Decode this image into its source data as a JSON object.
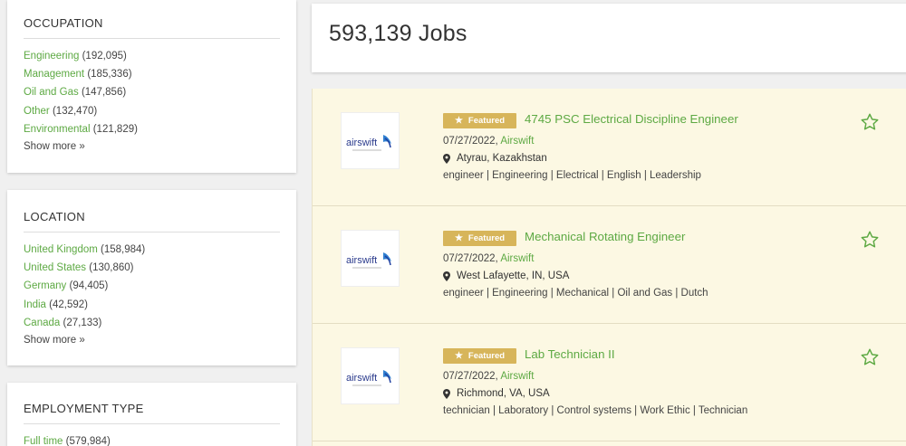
{
  "sidebar": {
    "facets": [
      {
        "title": "OCCUPATION",
        "items": [
          {
            "label": "Engineering",
            "count": "(192,095)"
          },
          {
            "label": "Management",
            "count": "(185,336)"
          },
          {
            "label": "Oil and Gas",
            "count": "(147,856)"
          },
          {
            "label": "Other",
            "count": "(132,470)"
          },
          {
            "label": "Environmental",
            "count": "(121,829)"
          }
        ],
        "show_more": "Show more »"
      },
      {
        "title": "LOCATION",
        "items": [
          {
            "label": "United Kingdom",
            "count": "(158,984)"
          },
          {
            "label": "United States",
            "count": "(130,860)"
          },
          {
            "label": "Germany",
            "count": "(94,405)"
          },
          {
            "label": "India",
            "count": "(42,592)"
          },
          {
            "label": "Canada",
            "count": "(27,133)"
          }
        ],
        "show_more": "Show more »"
      },
      {
        "title": "EMPLOYMENT TYPE",
        "items": [
          {
            "label": "Full time",
            "count": "(579,984)"
          }
        ]
      }
    ]
  },
  "results": {
    "count_text": "593,139 Jobs"
  },
  "jobs": [
    {
      "badge": "Featured",
      "title": "4745 PSC Electrical Discipline Engineer",
      "date": "07/27/2022,",
      "company": "Airswift",
      "location": "Atyrau, Kazakhstan",
      "tags": "engineer | Engineering | Electrical | English | Leadership",
      "logo_text": "airswift"
    },
    {
      "badge": "Featured",
      "title": "Mechanical Rotating Engineer",
      "date": "07/27/2022,",
      "company": "Airswift",
      "location": "West Lafayette, IN, USA",
      "tags": "engineer | Engineering | Mechanical | Oil and Gas | Dutch",
      "logo_text": "airswift"
    },
    {
      "badge": "Featured",
      "title": "Lab Technician II",
      "date": "07/27/2022,",
      "company": "Airswift",
      "location": "Richmond, VA, USA",
      "tags": "technician | Laboratory | Control systems | Work Ethic | Technician",
      "logo_text": "airswift"
    }
  ],
  "colors": {
    "link": "#5da943",
    "featured_bg": "#fcf8e3",
    "badge": "#d7b55a"
  },
  "icons": {
    "badge": "star-icon",
    "location": "map-pin-icon",
    "favorite": "star-outline-icon"
  }
}
